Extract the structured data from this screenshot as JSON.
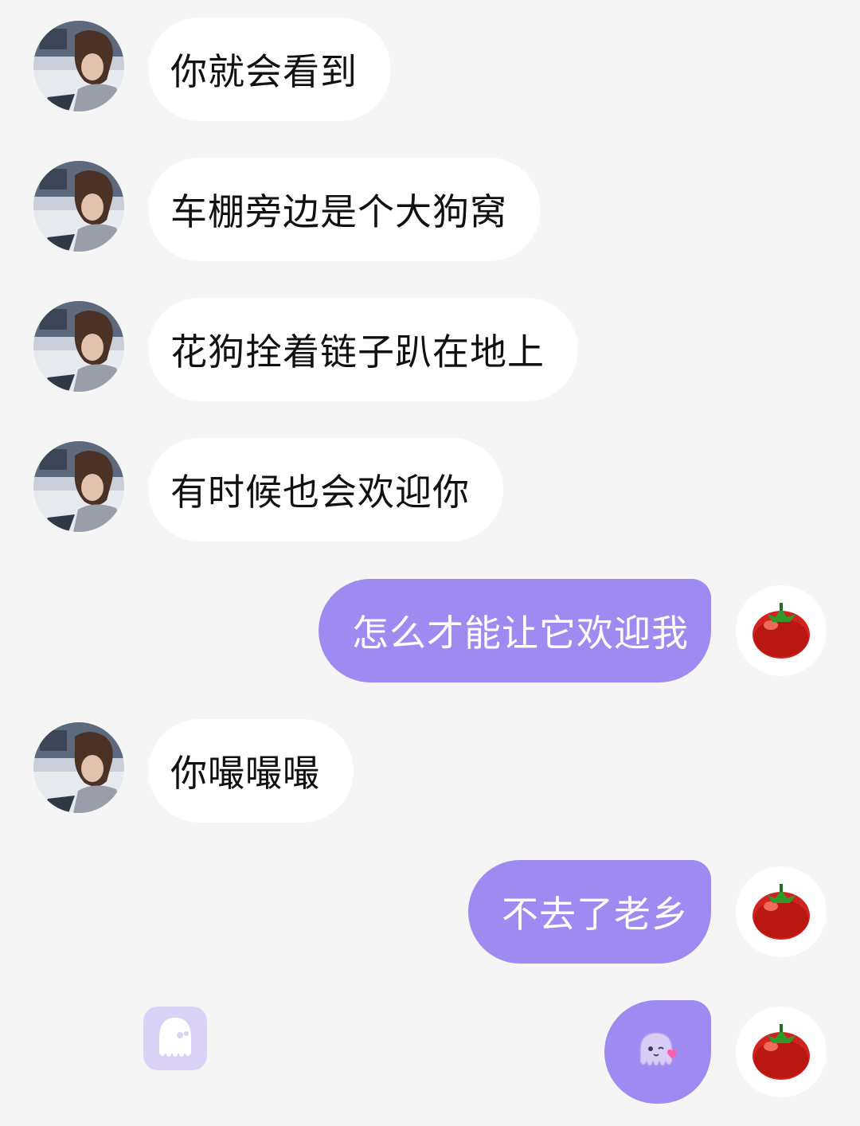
{
  "chat": {
    "messages": [
      {
        "side": "in",
        "text": "你就会看到"
      },
      {
        "side": "in",
        "text": "车棚旁边是个大狗窝"
      },
      {
        "side": "in",
        "text": "花狗拴着链子趴在地上"
      },
      {
        "side": "in",
        "text": "有时候也会欢迎你"
      },
      {
        "side": "out",
        "text": "怎么才能让它欢迎我"
      },
      {
        "side": "in",
        "text": "你嘬嘬嘬"
      },
      {
        "side": "out",
        "text": "不去了老乡"
      },
      {
        "side": "out",
        "sticker": "octopus-wink-heart-sticker"
      }
    ]
  },
  "icons": {
    "contact_avatar": "photo-avatar-curly-hair",
    "self_avatar": "tomato-icon",
    "app_logo": "octopus-logo-icon"
  },
  "colors": {
    "background": "#f5f5f5",
    "incoming_bubble": "#ffffff",
    "outgoing_bubble": "#9f8af2",
    "outgoing_text": "#ffffff",
    "incoming_text": "#111111"
  }
}
